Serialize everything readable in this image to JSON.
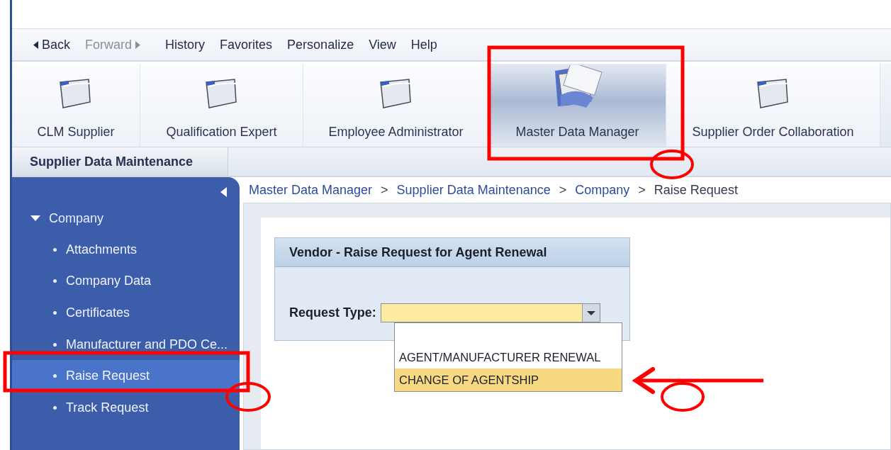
{
  "menu": [
    {
      "label": "Back",
      "kind": "back",
      "disabled": false
    },
    {
      "label": "Forward",
      "kind": "forward",
      "disabled": true
    },
    {
      "label": "History",
      "disabled": false
    },
    {
      "label": "Favorites",
      "disabled": false
    },
    {
      "label": "Personalize",
      "disabled": false
    },
    {
      "label": "View",
      "disabled": false
    },
    {
      "label": "Help",
      "disabled": false
    }
  ],
  "roles": [
    {
      "label": "CLM Supplier",
      "selected": false
    },
    {
      "label": "Qualification Expert",
      "selected": false
    },
    {
      "label": "Employee Administrator",
      "selected": false
    },
    {
      "label": "Master Data Manager",
      "selected": true
    },
    {
      "label": "Supplier Order Collaboration",
      "selected": false
    }
  ],
  "subtabs": [
    {
      "label": "Supplier Data Maintenance",
      "selected": true
    }
  ],
  "sidebar": {
    "items": [
      {
        "label": "Company",
        "expanded": true,
        "children": [
          {
            "label": "Attachments",
            "selected": false
          },
          {
            "label": "Company Data",
            "selected": false
          },
          {
            "label": "Certificates",
            "selected": false
          },
          {
            "label": "Manufacturer and PDO Ce...",
            "selected": false
          },
          {
            "label": "Raise Request",
            "selected": true
          },
          {
            "label": "Track Request",
            "selected": false
          }
        ]
      }
    ]
  },
  "breadcrumb": [
    {
      "kind": "link",
      "text": "Master Data Manager"
    },
    {
      "kind": "separator",
      "text": ">"
    },
    {
      "kind": "link",
      "text": "Supplier Data Maintenance"
    },
    {
      "kind": "separator",
      "text": ">"
    },
    {
      "kind": "link",
      "text": "Company"
    },
    {
      "kind": "separator",
      "text": ">"
    },
    {
      "kind": "current",
      "text": "Raise Request"
    }
  ],
  "panel": {
    "title": "Vendor - Raise Request for Agent Renewal",
    "field_label": "Request Type:",
    "dropdown": {
      "expanded": true,
      "options": [
        {
          "label": "AGENT/MANUFACTURER RENEWAL",
          "selected": false
        },
        {
          "label": "CHANGE OF AGENTSHIP",
          "selected": true
        }
      ]
    }
  },
  "annotations": [
    {
      "kind": "rectangle"
    },
    {
      "kind": "circle"
    },
    {
      "kind": "rectangle"
    },
    {
      "kind": "circle"
    },
    {
      "kind": "arrow"
    },
    {
      "kind": "circle"
    }
  ]
}
